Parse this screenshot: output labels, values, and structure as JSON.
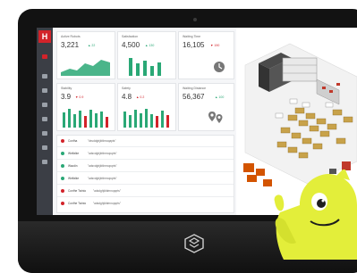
{
  "brand_mark": "H",
  "metrics": [
    {
      "title": "Active Robots",
      "value": "3,221",
      "change": "▲ 22",
      "dir": "up"
    },
    {
      "title": "Satisfaction",
      "value": "4,500",
      "change": "▲ 130",
      "dir": "up"
    },
    {
      "title": "Waiting Time",
      "value": "16,105",
      "change": "▼ 190",
      "dir": "down"
    },
    {
      "title": "Stability",
      "value": "3.9",
      "change": "▼ 0.9",
      "dir": "down"
    },
    {
      "title": "Safety",
      "value": "4.8",
      "change": "▲ 0.2",
      "dir": "down"
    },
    {
      "title": "Waiting Distance",
      "value": "56,367",
      "change": "▲ 100",
      "dir": "up"
    }
  ],
  "feed": [
    {
      "name": "Confha",
      "msg": "\"dsvddghjkfdmoqapts\"",
      "color": "#d2232a"
    },
    {
      "name": "Welfalke",
      "msg": "\"adsvdghjkfdmnopqrts\"",
      "color": "#2aa876"
    },
    {
      "name": "Wacdin",
      "msg": "\"adsvdghjkfdmnopqrts\"",
      "color": "#2aa876"
    },
    {
      "name": "Welfalke",
      "msg": "\"adsvdghjkfdmnopqrts\"",
      "color": "#2aa876"
    },
    {
      "name": "Confhe Twinio",
      "msg": "\"adsdghjkfdmnopqrts\"",
      "color": "#d2232a"
    },
    {
      "name": "Confhe Twinio",
      "msg": "\"adsdghjkfdmnopqrts\"",
      "color": "#d2232a"
    }
  ],
  "colors": {
    "accent": "#d2232a",
    "positive": "#2aa876",
    "sidebar": "#3b3e45",
    "mascot": "#e3ee3a"
  }
}
